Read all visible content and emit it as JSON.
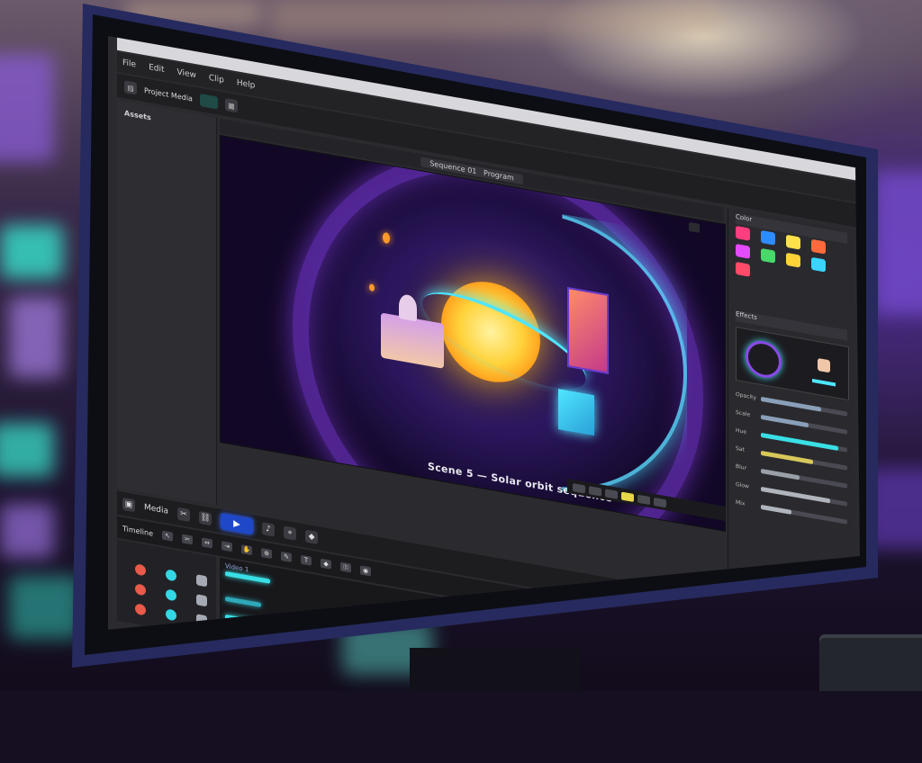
{
  "app": {
    "window_title": "",
    "menu": [
      "File",
      "Edit",
      "View",
      "Clip",
      "Help"
    ],
    "toolbar_label": "Project Media",
    "left_panel_title": "Assets"
  },
  "preview": {
    "header_left": "Sequence 01",
    "header_right": "Program",
    "caption": "Scene 5 — Solar orbit sequence"
  },
  "right_panel": {
    "section_color": "Color",
    "section_effects": "Effects",
    "swatch_colors": [
      "#ff3d7f",
      "#2f8cff",
      "#ffe14a",
      "#ff6a3d",
      "#e64aff",
      "#47d96a",
      "#ffd23a",
      "#3ad4ff",
      "#ff4a6a"
    ],
    "sliders": [
      {
        "label": "Opacity",
        "fill": 0.7,
        "color": "#8aa0b8"
      },
      {
        "label": "Scale",
        "fill": 0.55,
        "color": "#8aa0b8"
      },
      {
        "label": "Hue",
        "fill": 0.9,
        "color": "#3adfe6"
      },
      {
        "label": "Sat",
        "fill": 0.6,
        "color": "#d8c85a"
      },
      {
        "label": "Blur",
        "fill": 0.45,
        "color": "#9aa0a8"
      },
      {
        "label": "Glow",
        "fill": 0.8,
        "color": "#b0b4bc"
      },
      {
        "label": "Mix",
        "fill": 0.35,
        "color": "#b0b4bc"
      }
    ]
  },
  "transport": {
    "mode_label": "Media"
  },
  "timeline": {
    "label": "Timeline",
    "track_name": "Video 1",
    "clip_colors": [
      "#3adfe6",
      "#2fa8b8",
      "#3adfe6"
    ]
  }
}
